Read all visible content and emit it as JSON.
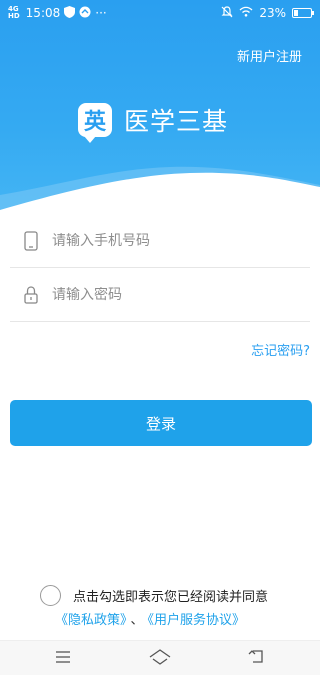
{
  "status_bar": {
    "network": [
      "4G",
      "HD"
    ],
    "time": "15:08",
    "dots": "···",
    "battery": "23%",
    "battery_level": 0.23
  },
  "header": {
    "register_link": "新用户注册",
    "brand_logo_char": "英",
    "brand_name": "医学三基"
  },
  "form": {
    "phone_placeholder": "请输入手机号码",
    "password_placeholder": "请输入密码",
    "forgot_link": "忘记密码?",
    "login_label": "登录"
  },
  "agreement": {
    "text": "点击勾选即表示您已经阅读并同意",
    "privacy_link": "《隐私政策》",
    "separator": "、",
    "service_link": "《用户服务协议》"
  },
  "colors": {
    "accent": "#1fa2ea",
    "header_top": "#2a9ff0"
  },
  "icons": {
    "phone": "phone-icon",
    "lock": "lock-icon",
    "menu": "menu-icon",
    "home": "home-icon",
    "back": "back-icon"
  }
}
